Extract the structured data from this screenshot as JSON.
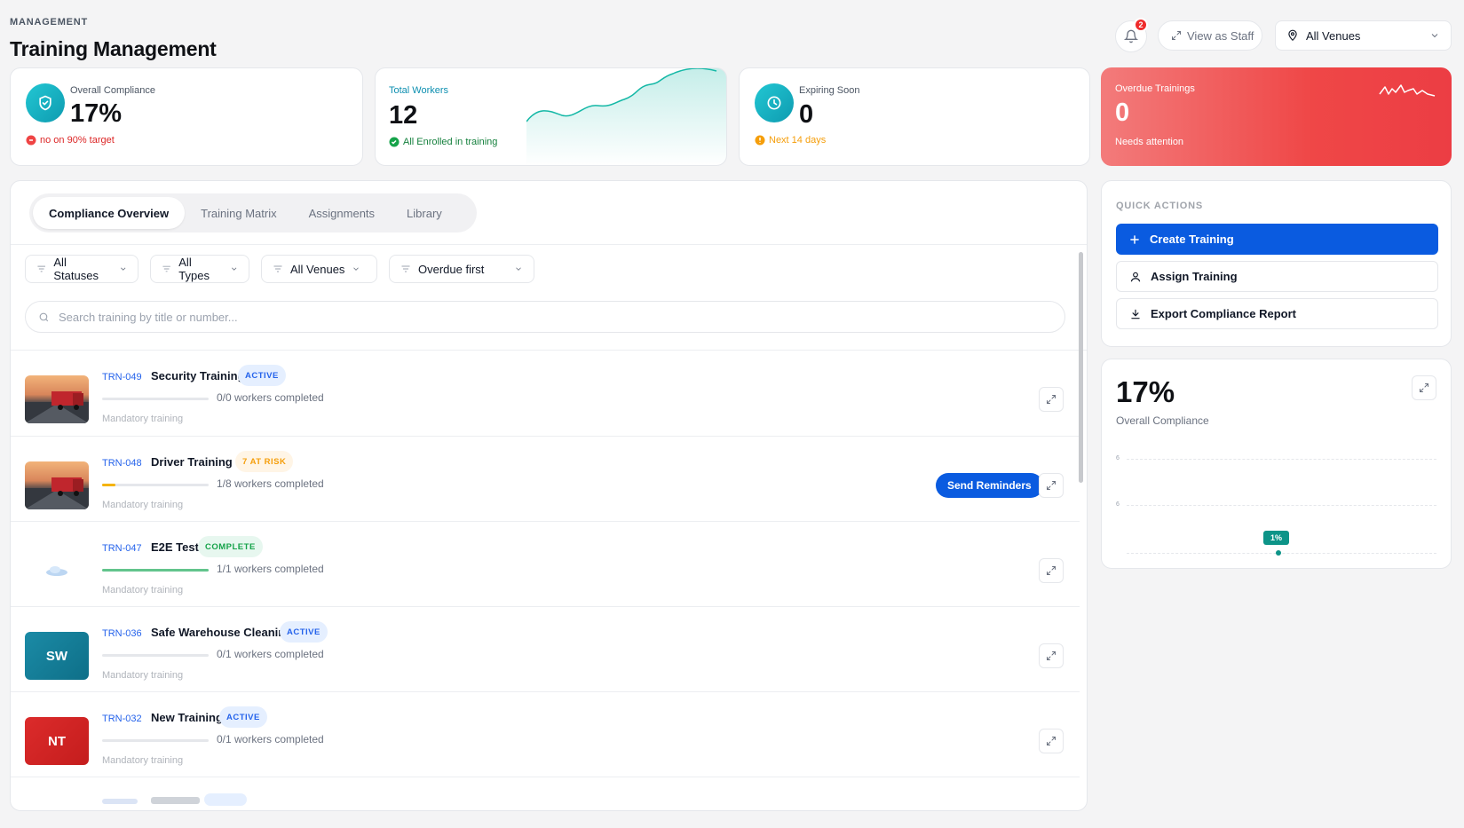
{
  "header": {
    "eyebrow": "MANAGEMENT",
    "title": "Training Management",
    "notification_count": "2",
    "view_as_staff": "View as Staff",
    "venue_select": "All Venues"
  },
  "stats": {
    "compliance": {
      "label": "Overall Compliance",
      "value": "17%",
      "note": "no on 90% target"
    },
    "workers": {
      "label": "Total Workers",
      "value": "12",
      "note": "All Enrolled in training"
    },
    "expiring": {
      "label": "Expiring Soon",
      "value": "0",
      "note": "Next 14 days"
    },
    "overdue": {
      "label": "Overdue Trainings",
      "value": "0",
      "note": "Needs attention"
    }
  },
  "tabs": [
    {
      "label": "Compliance Overview",
      "active": true
    },
    {
      "label": "Training Matrix"
    },
    {
      "label": "Assignments"
    },
    {
      "label": "Library"
    }
  ],
  "filters": {
    "status": "All Statuses",
    "type": "All Types",
    "venue": "All Venues",
    "sort": "Overdue first"
  },
  "search": {
    "placeholder": "Search training by title or number..."
  },
  "trainings": [
    {
      "code": "TRN-049",
      "title": "Security Training",
      "badge": "ACTIVE",
      "progress_text": "0/0 workers completed",
      "progress": 0,
      "category": "Mandatory training"
    },
    {
      "code": "TRN-048",
      "title": "Driver Training",
      "badge": "7 AT RISK",
      "progress_text": "1/8 workers completed",
      "progress": 0.125,
      "category": "Mandatory training",
      "action": "Send Reminders"
    },
    {
      "code": "TRN-047",
      "title": "E2E Test",
      "badge": "COMPLETE",
      "progress_text": "1/1 workers completed",
      "progress": 1,
      "category": "Mandatory training"
    },
    {
      "code": "TRN-036",
      "title": "Safe Warehouse Cleaning",
      "badge": "ACTIVE",
      "progress_text": "0/1 workers completed",
      "progress": 0,
      "category": "Mandatory training",
      "initials": "SW"
    },
    {
      "code": "TRN-032",
      "title": "New Training",
      "badge": "ACTIVE",
      "progress_text": "0/1 workers completed",
      "progress": 0,
      "category": "Mandatory training",
      "initials": "NT"
    }
  ],
  "quick_actions": {
    "title": "QUICK ACTIONS",
    "create": "Create Training",
    "assign": "Assign Training",
    "export": "Export Compliance Report"
  },
  "compliance_chart": {
    "value": "17%",
    "label": "Overall Compliance",
    "tick_top": "6",
    "tick_mid": "6",
    "point_label": "1%"
  },
  "colors": {
    "primary": "#0a5be0",
    "teal": "#14b8a6",
    "danger": "#ef4444",
    "warning": "#f59e0b",
    "success": "#16a34a"
  }
}
